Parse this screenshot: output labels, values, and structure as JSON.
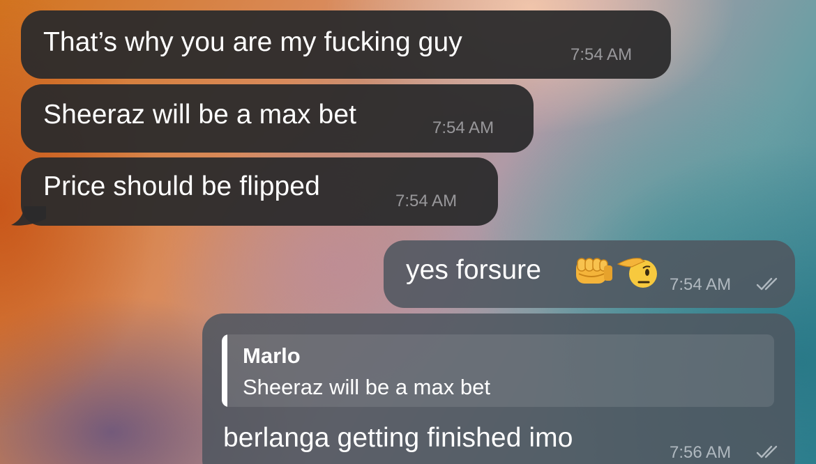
{
  "messages": [
    {
      "text": "That’s why you are my fucking guy",
      "time": "7:54 AM",
      "direction": "incoming"
    },
    {
      "text": "Sheeraz will be a max bet",
      "time": "7:54 AM",
      "direction": "incoming"
    },
    {
      "text": "Price should be flipped",
      "time": "7:54 AM",
      "direction": "incoming"
    },
    {
      "text": "yes forsure",
      "time": "7:54 AM",
      "direction": "outgoing",
      "emojis": [
        "oncoming-fist-emoji",
        "saluting-face-emoji"
      ],
      "status": "read"
    },
    {
      "text": "berlanga getting finished imo",
      "time": "7:56 AM",
      "direction": "outgoing",
      "status": "read",
      "reply_to": {
        "name": "Marlo",
        "text": "Sheeraz will be a max bet"
      }
    }
  ],
  "colors": {
    "incoming_bubble": "#2a2a2c",
    "outgoing_bubble": "#505660",
    "fist_emoji": "#f4b43a",
    "salute_emoji": "#f7c93e"
  }
}
